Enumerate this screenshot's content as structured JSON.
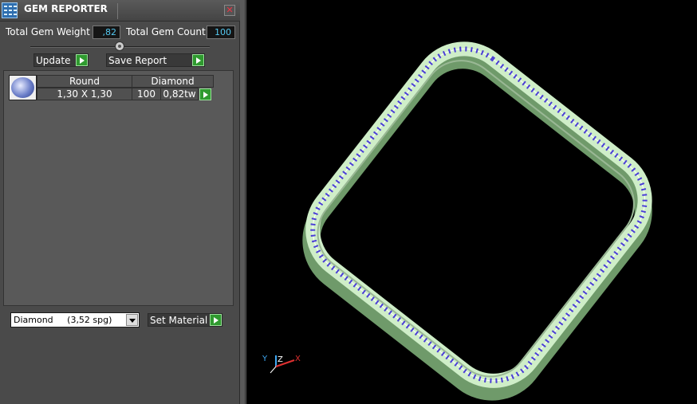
{
  "window": {
    "title": "GEM REPORTER",
    "close_glyph": "✕"
  },
  "stats": {
    "total_weight_label": "Total Gem Weight",
    "total_weight_value": ",82",
    "total_count_label": "Total Gem Count",
    "total_count_value": "100"
  },
  "actions": {
    "update_label": "Update",
    "save_label": "Save Report"
  },
  "gem_list": {
    "rows": [
      {
        "shape": "Round",
        "material": "Diamond",
        "size": "1,30 X 1,30",
        "count": "100",
        "weight": "0,82tw"
      }
    ]
  },
  "material": {
    "selected": "Diamond     (3,52 spg)",
    "set_label": "Set Material"
  },
  "viewport": {
    "background": "#000000",
    "model_color": "#c8f0c0",
    "gem_color": "#7b68ee",
    "axis": {
      "y": "Y",
      "z": "Z",
      "x": "X"
    },
    "axis_colors": {
      "y": "#3fa9f5",
      "z": "#ffffff",
      "x": "#e03030"
    }
  }
}
